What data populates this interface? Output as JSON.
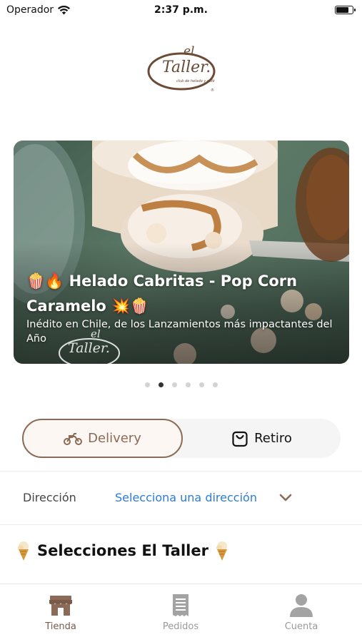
{
  "status_bar": {
    "carrier": "Operador",
    "time": "2:37 p.m.",
    "battery_level": 0.85,
    "wifi_icon": "wifi-icon"
  },
  "brand": {
    "logo_el": "el",
    "logo_name": "Taller.",
    "logo_tagline": "club de helado y café",
    "logo_reg": "®",
    "brand_color": "#6b4a36"
  },
  "banner": {
    "title": "🍿🔥 Helado Cabritas - Pop Corn Caramelo 💥🍿",
    "subtitle": "Inédito en Chile, de los Lanzamientos más impactantes del Año",
    "watermark_el": "el",
    "watermark_name": "Taller.",
    "slide_count": 6,
    "active_slide": 2
  },
  "order_mode": {
    "delivery_label": "Delivery",
    "pickup_label": "Retiro",
    "selected": "delivery",
    "accent_color": "#8b6a57"
  },
  "address": {
    "label": "Dirección",
    "link": "Selecciona una dirección",
    "link_color": "#2b7bd8"
  },
  "section": {
    "title": "Selecciones El Taller",
    "icon": "ice-cream-cone-icon"
  },
  "tabbar": {
    "tabs": [
      {
        "label": "Tienda",
        "icon": "store-icon",
        "active": true
      },
      {
        "label": "Pedidos",
        "icon": "receipt-icon",
        "active": false
      },
      {
        "label": "Cuenta",
        "icon": "user-icon",
        "active": false
      }
    ],
    "active_color": "#7a5a48",
    "inactive_color": "#9a9a9a"
  }
}
